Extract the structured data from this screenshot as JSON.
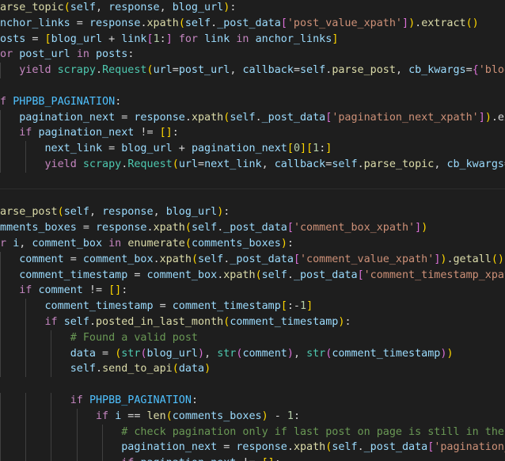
{
  "editor": {
    "language": "python",
    "theme": {
      "background": "#1e1e1e",
      "text": "#d4d4d4",
      "keyword": "#c586c0",
      "function": "#dcdcaa",
      "variable": "#9cdcfe",
      "constant": "#4fc1ff",
      "string": "#ce9178",
      "number": "#b5cea8",
      "comment": "#6a9955",
      "class": "#4ec9b0",
      "bracket_level_1": "#ffd700",
      "bracket_level_2": "#da70d6",
      "bracket_level_3": "#179fff"
    },
    "lines": [
      {
        "indent": 0,
        "tokens": [
          [
            "fn",
            "parse_topic"
          ],
          [
            "br1",
            "("
          ],
          [
            "var",
            "self"
          ],
          [
            "text",
            ", "
          ],
          [
            "var",
            "response"
          ],
          [
            "text",
            ", "
          ],
          [
            "var",
            "blog_url"
          ],
          [
            "br1",
            ")"
          ],
          [
            "text",
            ":"
          ]
        ]
      },
      {
        "indent": 0,
        "tokens": [
          [
            "var",
            "anchor_links"
          ],
          [
            "text",
            " = "
          ],
          [
            "var",
            "response"
          ],
          [
            "text",
            "."
          ],
          [
            "fn",
            "xpath"
          ],
          [
            "br1",
            "("
          ],
          [
            "var",
            "self"
          ],
          [
            "text",
            "."
          ],
          [
            "var",
            "_post_data"
          ],
          [
            "br2",
            "["
          ],
          [
            "str",
            "'post_value_xpath'"
          ],
          [
            "br2",
            "]"
          ],
          [
            "br1",
            ")"
          ],
          [
            "text",
            "."
          ],
          [
            "fn",
            "extract"
          ],
          [
            "br1",
            "()"
          ]
        ]
      },
      {
        "indent": 0,
        "tokens": [
          [
            "var",
            "posts"
          ],
          [
            "text",
            " = "
          ],
          [
            "br1",
            "["
          ],
          [
            "var",
            "blog_url"
          ],
          [
            "text",
            " + "
          ],
          [
            "var",
            "link"
          ],
          [
            "br2",
            "["
          ],
          [
            "num",
            "1"
          ],
          [
            "text",
            ":"
          ],
          [
            "br2",
            "]"
          ],
          [
            "text",
            " "
          ],
          [
            "kw",
            "for"
          ],
          [
            "text",
            " "
          ],
          [
            "var",
            "link"
          ],
          [
            "text",
            " "
          ],
          [
            "kw",
            "in"
          ],
          [
            "text",
            " "
          ],
          [
            "var",
            "anchor_links"
          ],
          [
            "br1",
            "]"
          ]
        ]
      },
      {
        "indent": 0,
        "tokens": [
          [
            "kw",
            "for"
          ],
          [
            "text",
            " "
          ],
          [
            "var",
            "post_url"
          ],
          [
            "text",
            " "
          ],
          [
            "kw",
            "in"
          ],
          [
            "text",
            " "
          ],
          [
            "var",
            "posts"
          ],
          [
            "text",
            ":"
          ]
        ]
      },
      {
        "indent": 1,
        "tokens": [
          [
            "kw",
            "yield"
          ],
          [
            "text",
            " "
          ],
          [
            "cls",
            "scrapy"
          ],
          [
            "text",
            "."
          ],
          [
            "cls",
            "Request"
          ],
          [
            "br1",
            "("
          ],
          [
            "var",
            "url"
          ],
          [
            "text",
            "="
          ],
          [
            "var",
            "post_url"
          ],
          [
            "text",
            ", "
          ],
          [
            "var",
            "callback"
          ],
          [
            "text",
            "="
          ],
          [
            "var",
            "self"
          ],
          [
            "text",
            "."
          ],
          [
            "fn",
            "parse_post"
          ],
          [
            "text",
            ", "
          ],
          [
            "var",
            "cb_kwargs"
          ],
          [
            "text",
            "="
          ],
          [
            "br2",
            "{"
          ],
          [
            "str",
            "'blog"
          ]
        ]
      },
      {
        "indent": 0,
        "tokens": []
      },
      {
        "indent": 0,
        "tokens": [
          [
            "kw",
            "if"
          ],
          [
            "text",
            " "
          ],
          [
            "const",
            "PHPBB_PAGINATION"
          ],
          [
            "text",
            ":"
          ]
        ]
      },
      {
        "indent": 1,
        "tokens": [
          [
            "var",
            "pagination_next"
          ],
          [
            "text",
            " = "
          ],
          [
            "var",
            "response"
          ],
          [
            "text",
            "."
          ],
          [
            "fn",
            "xpath"
          ],
          [
            "br1",
            "("
          ],
          [
            "var",
            "self"
          ],
          [
            "text",
            "."
          ],
          [
            "var",
            "_post_data"
          ],
          [
            "br2",
            "["
          ],
          [
            "str",
            "'pagination_next_xpath'"
          ],
          [
            "br2",
            "]"
          ],
          [
            "br1",
            ")"
          ],
          [
            "text",
            ".ex"
          ]
        ]
      },
      {
        "indent": 1,
        "tokens": [
          [
            "kw",
            "if"
          ],
          [
            "text",
            " "
          ],
          [
            "var",
            "pagination_next"
          ],
          [
            "text",
            " != "
          ],
          [
            "br1",
            "[]"
          ],
          [
            "text",
            ":"
          ]
        ]
      },
      {
        "indent": 2,
        "tokens": [
          [
            "var",
            "next_link"
          ],
          [
            "text",
            " = "
          ],
          [
            "var",
            "blog_url"
          ],
          [
            "text",
            " + "
          ],
          [
            "var",
            "pagination_next"
          ],
          [
            "br1",
            "["
          ],
          [
            "num",
            "0"
          ],
          [
            "br1",
            "]"
          ],
          [
            "br1",
            "["
          ],
          [
            "num",
            "1"
          ],
          [
            "text",
            ":"
          ],
          [
            "br1",
            "]"
          ]
        ]
      },
      {
        "indent": 2,
        "tokens": [
          [
            "kw",
            "yield"
          ],
          [
            "text",
            " "
          ],
          [
            "cls",
            "scrapy"
          ],
          [
            "text",
            "."
          ],
          [
            "cls",
            "Request"
          ],
          [
            "br1",
            "("
          ],
          [
            "var",
            "url"
          ],
          [
            "text",
            "="
          ],
          [
            "var",
            "next_link"
          ],
          [
            "text",
            ", "
          ],
          [
            "var",
            "callback"
          ],
          [
            "text",
            "="
          ],
          [
            "var",
            "self"
          ],
          [
            "text",
            "."
          ],
          [
            "fn",
            "parse_topic"
          ],
          [
            "text",
            ", "
          ],
          [
            "var",
            "cb_kwargs"
          ],
          [
            "text",
            "="
          ]
        ]
      },
      {
        "indent": 0,
        "tokens": [],
        "separator": true
      },
      {
        "indent": 0,
        "tokens": []
      },
      {
        "indent": 0,
        "tokens": [
          [
            "fn",
            "parse_post"
          ],
          [
            "br1",
            "("
          ],
          [
            "var",
            "self"
          ],
          [
            "text",
            ", "
          ],
          [
            "var",
            "response"
          ],
          [
            "text",
            ", "
          ],
          [
            "var",
            "blog_url"
          ],
          [
            "br1",
            ")"
          ],
          [
            "text",
            ":"
          ]
        ]
      },
      {
        "indent": 0,
        "tokens": [
          [
            "var",
            "omments_boxes"
          ],
          [
            "text",
            " = "
          ],
          [
            "var",
            "response"
          ],
          [
            "text",
            "."
          ],
          [
            "fn",
            "xpath"
          ],
          [
            "br1",
            "("
          ],
          [
            "var",
            "self"
          ],
          [
            "text",
            "."
          ],
          [
            "var",
            "_post_data"
          ],
          [
            "br2",
            "["
          ],
          [
            "str",
            "'comment_box_xpath'"
          ],
          [
            "br2",
            "]"
          ],
          [
            "br1",
            ")"
          ]
        ]
      },
      {
        "indent": 0,
        "tokens": [
          [
            "kw",
            "or"
          ],
          [
            "text",
            " "
          ],
          [
            "var",
            "i"
          ],
          [
            "text",
            ", "
          ],
          [
            "var",
            "comment_box"
          ],
          [
            "text",
            " "
          ],
          [
            "kw",
            "in"
          ],
          [
            "text",
            " "
          ],
          [
            "bi",
            "enumerate"
          ],
          [
            "br1",
            "("
          ],
          [
            "var",
            "comments_boxes"
          ],
          [
            "br1",
            ")"
          ],
          [
            "text",
            ":"
          ]
        ]
      },
      {
        "indent": 1,
        "tokens": [
          [
            "var",
            "comment"
          ],
          [
            "text",
            " = "
          ],
          [
            "var",
            "comment_box"
          ],
          [
            "text",
            "."
          ],
          [
            "fn",
            "xpath"
          ],
          [
            "br1",
            "("
          ],
          [
            "var",
            "self"
          ],
          [
            "text",
            "."
          ],
          [
            "var",
            "_post_data"
          ],
          [
            "br2",
            "["
          ],
          [
            "str",
            "'comment_value_xpath'"
          ],
          [
            "br2",
            "]"
          ],
          [
            "br1",
            ")"
          ],
          [
            "text",
            "."
          ],
          [
            "fn",
            "getall"
          ],
          [
            "br1",
            "()"
          ]
        ]
      },
      {
        "indent": 1,
        "tokens": [
          [
            "var",
            "comment_timestamp"
          ],
          [
            "text",
            " = "
          ],
          [
            "var",
            "comment_box"
          ],
          [
            "text",
            "."
          ],
          [
            "fn",
            "xpath"
          ],
          [
            "br1",
            "("
          ],
          [
            "var",
            "self"
          ],
          [
            "text",
            "."
          ],
          [
            "var",
            "_post_data"
          ],
          [
            "br2",
            "["
          ],
          [
            "str",
            "'comment_timestamp_xpat"
          ]
        ]
      },
      {
        "indent": 1,
        "tokens": [
          [
            "kw",
            "if"
          ],
          [
            "text",
            " "
          ],
          [
            "var",
            "comment"
          ],
          [
            "text",
            " != "
          ],
          [
            "br1",
            "[]"
          ],
          [
            "text",
            ":"
          ]
        ]
      },
      {
        "indent": 2,
        "tokens": [
          [
            "var",
            "comment_timestamp"
          ],
          [
            "text",
            " = "
          ],
          [
            "var",
            "comment_timestamp"
          ],
          [
            "br1",
            "["
          ],
          [
            "text",
            ":-"
          ],
          [
            "num",
            "1"
          ],
          [
            "br1",
            "]"
          ]
        ]
      },
      {
        "indent": 2,
        "tokens": [
          [
            "kw",
            "if"
          ],
          [
            "text",
            " "
          ],
          [
            "var",
            "self"
          ],
          [
            "text",
            "."
          ],
          [
            "fn",
            "posted_in_last_month"
          ],
          [
            "br1",
            "("
          ],
          [
            "var",
            "comment_timestamp"
          ],
          [
            "br1",
            ")"
          ],
          [
            "text",
            ":"
          ]
        ]
      },
      {
        "indent": 3,
        "tokens": [
          [
            "cmt",
            "# Found a valid post"
          ]
        ]
      },
      {
        "indent": 3,
        "tokens": [
          [
            "var",
            "data"
          ],
          [
            "text",
            " = "
          ],
          [
            "br1",
            "("
          ],
          [
            "cls",
            "str"
          ],
          [
            "br2",
            "("
          ],
          [
            "var",
            "blog_url"
          ],
          [
            "br2",
            ")"
          ],
          [
            "text",
            ", "
          ],
          [
            "cls",
            "str"
          ],
          [
            "br2",
            "("
          ],
          [
            "var",
            "comment"
          ],
          [
            "br2",
            ")"
          ],
          [
            "text",
            ", "
          ],
          [
            "cls",
            "str"
          ],
          [
            "br2",
            "("
          ],
          [
            "var",
            "comment_timestamp"
          ],
          [
            "br2",
            ")"
          ],
          [
            "br1",
            ")"
          ]
        ]
      },
      {
        "indent": 3,
        "tokens": [
          [
            "var",
            "self"
          ],
          [
            "text",
            "."
          ],
          [
            "fn",
            "send_to_api"
          ],
          [
            "br1",
            "("
          ],
          [
            "var",
            "data"
          ],
          [
            "br1",
            ")"
          ]
        ]
      },
      {
        "indent": 0,
        "tokens": []
      },
      {
        "indent": 3,
        "tokens": [
          [
            "kw",
            "if"
          ],
          [
            "text",
            " "
          ],
          [
            "const",
            "PHPBB_PAGINATION"
          ],
          [
            "text",
            ":"
          ]
        ]
      },
      {
        "indent": 4,
        "tokens": [
          [
            "kw",
            "if"
          ],
          [
            "text",
            " "
          ],
          [
            "var",
            "i"
          ],
          [
            "text",
            " == "
          ],
          [
            "bi",
            "len"
          ],
          [
            "br1",
            "("
          ],
          [
            "var",
            "comments_boxes"
          ],
          [
            "br1",
            ")"
          ],
          [
            "text",
            " - "
          ],
          [
            "num",
            "1"
          ],
          [
            "text",
            ":"
          ]
        ]
      },
      {
        "indent": 5,
        "tokens": [
          [
            "cmt",
            "# check pagination only if last post on page is still in the"
          ]
        ]
      },
      {
        "indent": 5,
        "tokens": [
          [
            "var",
            "pagination_next"
          ],
          [
            "text",
            " = "
          ],
          [
            "var",
            "response"
          ],
          [
            "text",
            "."
          ],
          [
            "fn",
            "xpath"
          ],
          [
            "br1",
            "("
          ],
          [
            "var",
            "self"
          ],
          [
            "text",
            "."
          ],
          [
            "var",
            "_post_data"
          ],
          [
            "br2",
            "["
          ],
          [
            "str",
            "'pagination_"
          ]
        ]
      },
      {
        "indent": 5,
        "tokens": [
          [
            "kw",
            "if"
          ],
          [
            "text",
            " "
          ],
          [
            "var",
            "pagination_next"
          ],
          [
            "text",
            " != "
          ],
          [
            "br1",
            "[]"
          ],
          [
            "text",
            ":"
          ]
        ]
      }
    ]
  }
}
